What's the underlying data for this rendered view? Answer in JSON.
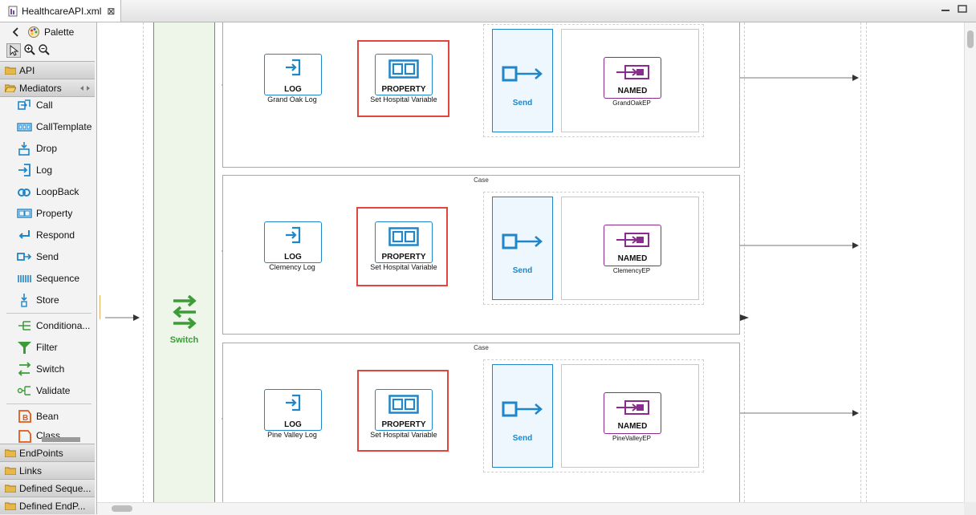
{
  "editor_tab": {
    "title": "HealthcareAPI.xml",
    "close": "⊠"
  },
  "palette": {
    "title": "Palette",
    "sections": {
      "api": "API",
      "mediators": "Mediators",
      "endpoints": "EndPoints",
      "links": "Links",
      "defined_sequences": "Defined Seque...",
      "defined_endpoints": "Defined EndP..."
    },
    "items": {
      "call": "Call",
      "calltemplate": "CallTemplate",
      "drop": "Drop",
      "log": "Log",
      "loopback": "LoopBack",
      "property": "Property",
      "respond": "Respond",
      "send": "Send",
      "sequence": "Sequence",
      "store": "Store",
      "conditional": "Conditiona...",
      "filter": "Filter",
      "switch": "Switch",
      "validate": "Validate",
      "bean": "Bean",
      "class": "Class"
    }
  },
  "canvas": {
    "switch_label": "Switch",
    "cases": [
      {
        "label": "",
        "log_type": "LOG",
        "log_name": "Grand Oak Log",
        "prop_type": "PROPERTY",
        "prop_name": "Set Hospital Variable",
        "send_label": "Send",
        "ep_type": "NAMED",
        "ep_name": "GrandOakEP"
      },
      {
        "label": "Case",
        "log_type": "LOG",
        "log_name": "Clemency Log",
        "prop_type": "PROPERTY",
        "prop_name": "Set Hospital Variable",
        "send_label": "Send",
        "ep_type": "NAMED",
        "ep_name": "ClemencyEP"
      },
      {
        "label": "Case",
        "log_type": "LOG",
        "log_name": "Pine Valley Log",
        "prop_type": "PROPERTY",
        "prop_name": "Set Hospital Variable",
        "send_label": "Send",
        "ep_type": "NAMED",
        "ep_name": "PineValleyEP"
      }
    ]
  },
  "colors": {
    "mediator_blue": "#1f86c9",
    "switch_green": "#3d9b3a",
    "endpoint_purple": "#8b2b8e",
    "highlight_red": "#e0463f"
  }
}
